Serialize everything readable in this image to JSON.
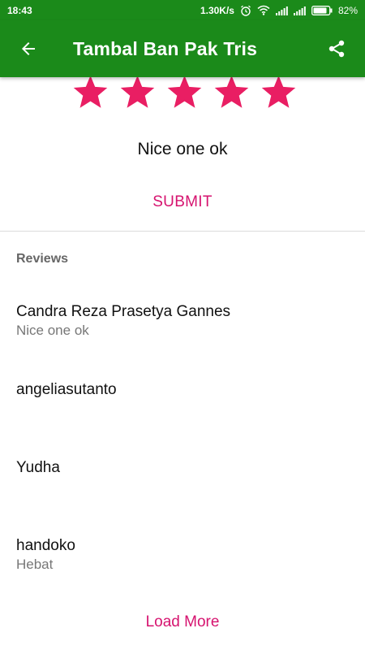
{
  "status_bar": {
    "time": "18:43",
    "network_speed": "1.30K/s",
    "battery": "82%",
    "icons": [
      "alarm-icon",
      "wifi-icon",
      "signal-icon",
      "signal-icon",
      "battery-icon"
    ]
  },
  "app_bar": {
    "title": "Tambal Ban Pak Tris",
    "back_icon": "arrow-left-icon",
    "share_icon": "share-icon",
    "color": "#1b8a1a"
  },
  "rating": {
    "value": 5,
    "max": 5,
    "color": "#e91e63"
  },
  "review_input": {
    "value": "Nice one ok"
  },
  "submit_label": "SUBMIT",
  "reviews": {
    "title": "Reviews",
    "items": [
      {
        "name": "Candra Reza Prasetya Gannes",
        "comment": "Nice one ok"
      },
      {
        "name": "angeliasutanto",
        "comment": ""
      },
      {
        "name": "Yudha",
        "comment": ""
      },
      {
        "name": "handoko",
        "comment": "Hebat"
      }
    ]
  },
  "load_more_label": "Load More",
  "accent_color": "#d6136f"
}
